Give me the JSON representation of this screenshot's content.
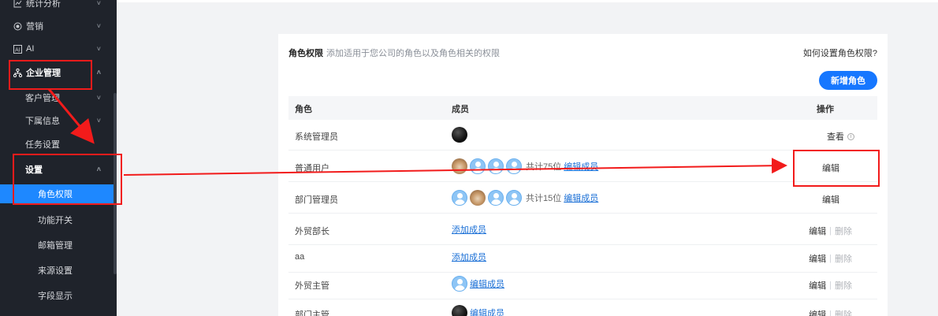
{
  "sidebar": {
    "items": [
      {
        "label": "统计分析",
        "icon": "chart-icon"
      },
      {
        "label": "营销",
        "icon": "target-icon"
      },
      {
        "label": "AI",
        "icon": "ai-icon"
      },
      {
        "label": "企业管理",
        "icon": "org-icon"
      },
      {
        "label": "客户管理"
      },
      {
        "label": "下属信息"
      },
      {
        "label": "任务设置"
      },
      {
        "label": "设置"
      },
      {
        "label": "角色权限"
      },
      {
        "label": "功能开关"
      },
      {
        "label": "邮箱管理"
      },
      {
        "label": "来源设置"
      },
      {
        "label": "字段显示"
      }
    ]
  },
  "card": {
    "title": "角色权限",
    "subtitle": "添加适用于您公司的角色以及角色相关的权限",
    "help": "如何设置角色权限?",
    "add_button": "新增角色"
  },
  "table": {
    "headers": [
      "角色",
      "成员",
      "操作"
    ],
    "rows": [
      {
        "name": "系统管理员",
        "avatars": [
          "dark"
        ],
        "count": "",
        "link": "",
        "ops": [
          "查看"
        ]
      },
      {
        "name": "普通用户",
        "avatars": [
          "dog",
          "blue",
          "blue",
          "blue"
        ],
        "count": "共计75位",
        "link": "编辑成员",
        "ops": [
          "编辑"
        ]
      },
      {
        "name": "部门管理员",
        "avatars": [
          "blue",
          "dog",
          "blue",
          "blue"
        ],
        "count": "共计15位",
        "link": "编辑成员",
        "ops": [
          "编辑"
        ]
      },
      {
        "name": "外贸部长",
        "avatars": [],
        "count": "",
        "link": "添加成员",
        "ops": [
          "编辑",
          "删除"
        ]
      },
      {
        "name": "aa",
        "avatars": [],
        "count": "",
        "link": "添加成员",
        "ops": [
          "编辑",
          "删除"
        ]
      },
      {
        "name": "外贸主管",
        "avatars": [
          "blue"
        ],
        "count": "",
        "link": "编辑成员",
        "ops": [
          "编辑",
          "删除"
        ]
      },
      {
        "name": "部门主管",
        "avatars": [
          "dark"
        ],
        "count": "",
        "link": "编辑成员",
        "ops": [
          "编辑",
          "删除"
        ]
      }
    ]
  },
  "colors": {
    "sidebar_bg": "#1f232b",
    "active": "#1e88ff",
    "primary": "#1677ff",
    "annotation": "#f21b1b"
  }
}
